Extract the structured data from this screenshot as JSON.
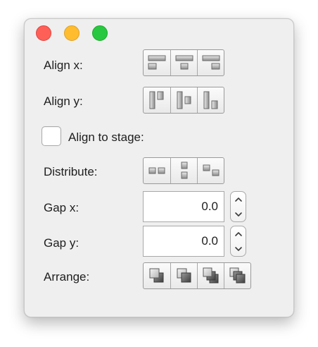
{
  "window": {
    "controls": [
      "close",
      "minimize",
      "zoom"
    ]
  },
  "align_x": {
    "label": "Align x:",
    "buttons": [
      "align-left-icon",
      "align-center-horizontal-icon",
      "align-right-icon"
    ]
  },
  "align_y": {
    "label": "Align y:",
    "buttons": [
      "align-top-icon",
      "align-center-vertical-icon",
      "align-bottom-icon"
    ]
  },
  "align_to_stage": {
    "label": "Align to stage:",
    "checked": false
  },
  "distribute": {
    "label": "Distribute:",
    "buttons": [
      "distribute-horizontal-icon",
      "distribute-vertical-icon",
      "distribute-diagonal-icon"
    ]
  },
  "gap_x": {
    "label": "Gap x:",
    "value": "0.0"
  },
  "gap_y": {
    "label": "Gap y:",
    "value": "0.0"
  },
  "arrange": {
    "label": "Arrange:",
    "buttons": [
      "bring-to-front-icon",
      "send-to-back-icon",
      "bring-forward-icon",
      "send-backward-icon"
    ]
  },
  "colors": {
    "window_bg": "#efefef",
    "close": "#fe5f57",
    "minimize": "#febc2e",
    "zoom": "#28c840"
  }
}
